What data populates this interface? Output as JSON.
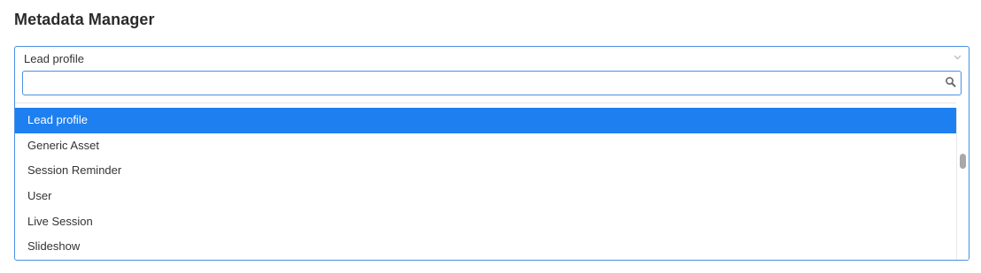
{
  "page": {
    "title": "Metadata Manager"
  },
  "select": {
    "selected_value": "Lead profile",
    "search_value": "",
    "search_placeholder": "",
    "chevron_icon": "chevron-down-icon",
    "search_icon": "search-icon",
    "options": [
      {
        "label": "Lead profile",
        "selected": true
      },
      {
        "label": "Generic Asset",
        "selected": false
      },
      {
        "label": "Session Reminder",
        "selected": false
      },
      {
        "label": "User",
        "selected": false
      },
      {
        "label": "Live Session",
        "selected": false
      },
      {
        "label": "Slideshow",
        "selected": false
      }
    ]
  },
  "colors": {
    "accent": "#4a90e2",
    "selected_bg": "#1e7ff0",
    "text": "#333333"
  }
}
